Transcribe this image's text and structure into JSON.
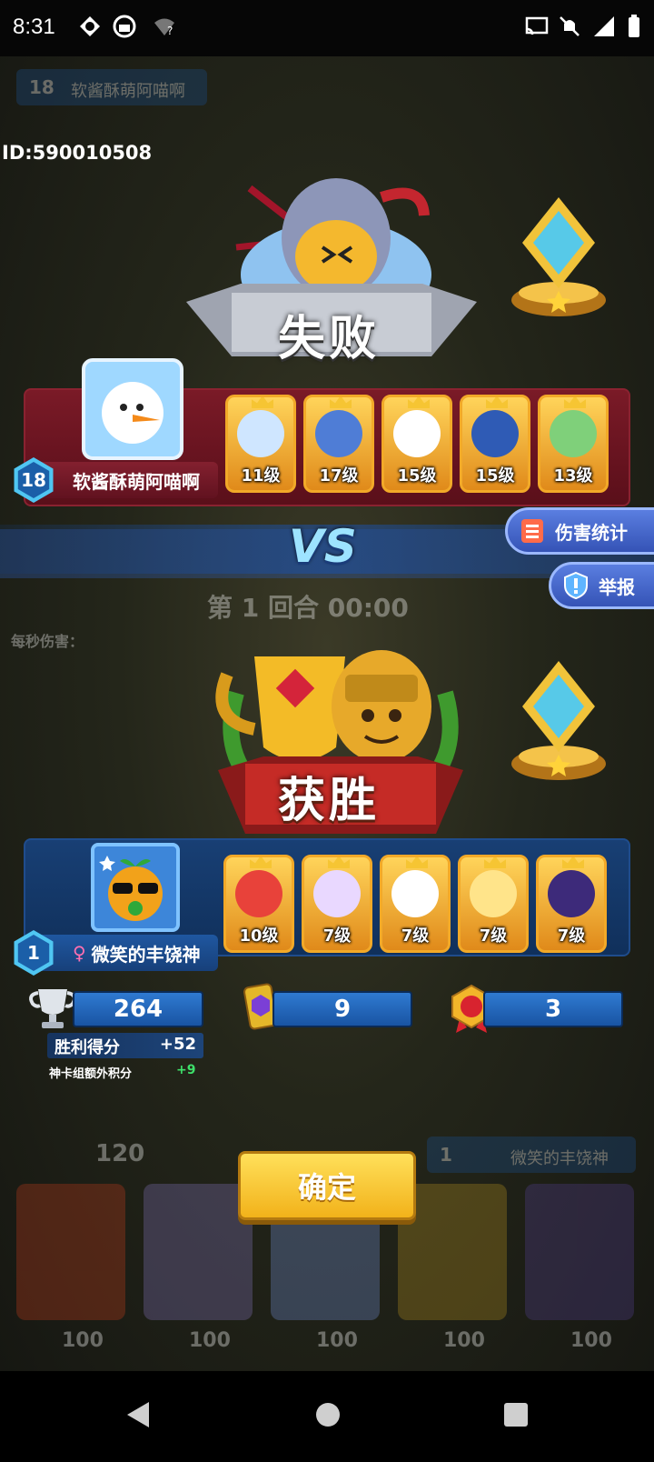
{
  "status_bar": {
    "time": "8:31",
    "left_icons": [
      "app-icon",
      "app-icon-2",
      "wifi-question-icon"
    ],
    "right_icons": [
      "cast-icon",
      "mute-icon",
      "signal-icon",
      "battery-icon"
    ]
  },
  "user_id": "ID:590010508",
  "loser": {
    "result_label": "失败",
    "player_level": "18",
    "player_name": "软酱酥萌阿喵啊",
    "cards": [
      {
        "level": "11级",
        "color": "#cfe6ff",
        "icon": "snowman-icon"
      },
      {
        "level": "17级",
        "color": "#4f7dd6",
        "icon": "knight-icon"
      },
      {
        "level": "15级",
        "color": "#ffffff",
        "icon": "clown-icon"
      },
      {
        "level": "15级",
        "color": "#2f5bb5",
        "icon": "chef-icon"
      },
      {
        "level": "13级",
        "color": "#7fd07a",
        "icon": "zombie-icon"
      }
    ]
  },
  "vs_label": "VS",
  "buttons": {
    "damage_stats": "伤害统计",
    "report": "举报",
    "confirm": "确定"
  },
  "background": {
    "round_text": "第 1 回合 00:00",
    "dps_label": "每秒伤害：",
    "top_player_level": "18",
    "top_player_name": "软酱酥萌阿喵啊",
    "score_value": "120",
    "bottom_player_level": "1",
    "bottom_player_name": "微笑的丰饶神",
    "card_costs": [
      "100",
      "100",
      "100",
      "100",
      "100"
    ]
  },
  "winner": {
    "result_label": "获胜",
    "player_level": "1",
    "player_name": "微笑的丰饶神",
    "cards": [
      {
        "level": "10级",
        "color": "#e8423a",
        "icon": "king-icon"
      },
      {
        "level": "7级",
        "color": "#e9d8ff",
        "icon": "angel-icon"
      },
      {
        "level": "7级",
        "color": "#ffffff",
        "icon": "clown-icon"
      },
      {
        "level": "7级",
        "color": "#ffe48a",
        "icon": "elder-icon"
      },
      {
        "level": "7级",
        "color": "#3d2a7a",
        "icon": "mage-icon"
      }
    ]
  },
  "stats": {
    "trophy_value": "264",
    "card_value": "9",
    "medal_value": "3",
    "win_score_label": "胜利得分",
    "win_score_delta": "+52",
    "extra_points_label": "神卡组额外积分",
    "extra_points_delta": "+9"
  },
  "colors": {
    "loser_panel": "#6b1420",
    "winner_panel": "#13315c",
    "confirm_button": "#f6bf1a",
    "level_tag": "#4fc6f2"
  }
}
